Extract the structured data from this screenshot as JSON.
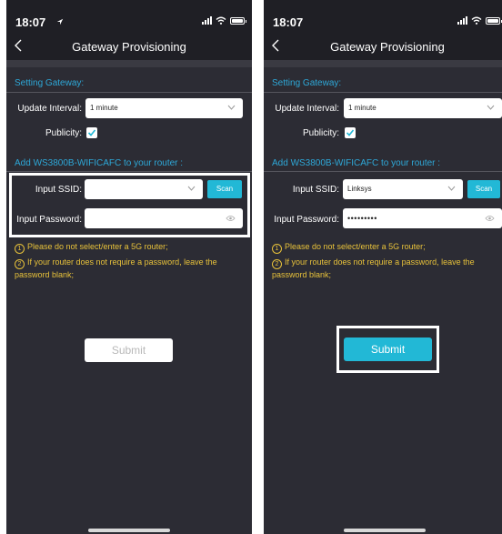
{
  "colors": {
    "accent": "#22b8d6",
    "section_title": "#2ea8d8",
    "warning": "#e8c23a",
    "background": "#2c2c34"
  },
  "screens": [
    {
      "status_time": "18:07",
      "nav_title": "Gateway Provisioning",
      "section_setting": "Setting Gateway:",
      "update_interval_label": "Update Interval:",
      "update_interval_value": "1 minute",
      "publicity_label": "Publicity:",
      "publicity_checked": true,
      "section_add": "Add WS3800B-WIFICAFC to your router :",
      "ssid_label": "Input SSID:",
      "ssid_value": "",
      "scan_label": "Scan",
      "password_label": "Input Password:",
      "password_value": "",
      "note_1_num": "1",
      "note_1": "Please do not select/enter a 5G router;",
      "note_2_num": "2",
      "note_2": "If your router does not require a password, leave the password blank;",
      "submit_label": "Submit",
      "submit_enabled": false
    },
    {
      "status_time": "18:07",
      "nav_title": "Gateway Provisioning",
      "section_setting": "Setting Gateway:",
      "update_interval_label": "Update Interval:",
      "update_interval_value": "1 minute",
      "publicity_label": "Publicity:",
      "publicity_checked": true,
      "section_add": "Add WS3800B-WIFICAFC to your router :",
      "ssid_label": "Input SSID:",
      "ssid_value": "Linksys",
      "scan_label": "Scan",
      "password_label": "Input Password:",
      "password_value": "•••••••••",
      "note_1_num": "1",
      "note_1": "Please do not select/enter a 5G router;",
      "note_2_num": "2",
      "note_2": "If your router does not require a password, leave the password blank;",
      "submit_label": "Submit",
      "submit_enabled": true
    }
  ]
}
